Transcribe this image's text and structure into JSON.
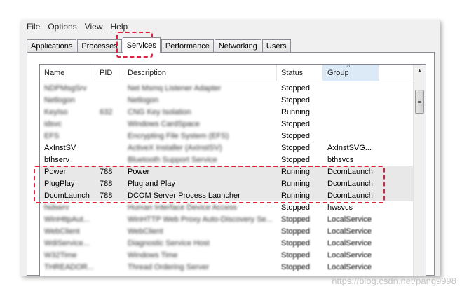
{
  "menu": [
    "File",
    "Options",
    "View",
    "Help"
  ],
  "tabs": [
    "Applications",
    "Processes",
    "Services",
    "Performance",
    "Networking",
    "Users"
  ],
  "active_tab": "Services",
  "columns": [
    "Name",
    "PID",
    "Description",
    "Status",
    "Group"
  ],
  "sorted_column": "Group",
  "rows": [
    {
      "name": "NDPMsgSrv",
      "pid": "",
      "desc": "Net Msmq Listener Adapter",
      "status": "Stopped",
      "group": ""
    },
    {
      "name": "Netlogon",
      "pid": "",
      "desc": "Netlogon",
      "status": "Stopped",
      "group": ""
    },
    {
      "name": "KeyIso",
      "pid": "632",
      "desc": "CNG Key Isolation",
      "status": "Running",
      "group": ""
    },
    {
      "name": "idsvc",
      "pid": "",
      "desc": "Windows CardSpace",
      "status": "Stopped",
      "group": ""
    },
    {
      "name": "EFS",
      "pid": "",
      "desc": "Encrypting File System (EFS)",
      "status": "Stopped",
      "group": ""
    },
    {
      "name": "AxInstSV",
      "pid": "",
      "desc": "ActiveX Installer (AxInstSV)",
      "status": "Stopped",
      "group": "AxInstSVG..."
    },
    {
      "name": "bthserv",
      "pid": "",
      "desc": "Bluetooth Support Service",
      "status": "Stopped",
      "group": "bthsvcs"
    },
    {
      "name": "Power",
      "pid": "788",
      "desc": "Power",
      "status": "Running",
      "group": "DcomLaunch"
    },
    {
      "name": "PlugPlay",
      "pid": "788",
      "desc": "Plug and Play",
      "status": "Running",
      "group": "DcomLaunch"
    },
    {
      "name": "DcomLaunch",
      "pid": "788",
      "desc": "DCOM Server Process Launcher",
      "status": "Running",
      "group": "DcomLaunch"
    },
    {
      "name": "hidserv",
      "pid": "",
      "desc": "Human Interface Device Access",
      "status": "Stopped",
      "group": "hwsvcs"
    },
    {
      "name": "WinHttpAut...",
      "pid": "",
      "desc": "WinHTTP Web Proxy Auto-Discovery Se...",
      "status": "Stopped",
      "group": "LocalService"
    },
    {
      "name": "WebClient",
      "pid": "",
      "desc": "WebClient",
      "status": "Stopped",
      "group": "LocalService"
    },
    {
      "name": "WdiService...",
      "pid": "",
      "desc": "Diagnostic Service Host",
      "status": "Stopped",
      "group": "LocalService"
    },
    {
      "name": "W32Time",
      "pid": "",
      "desc": "Windows Time",
      "status": "Stopped",
      "group": "LocalService"
    },
    {
      "name": "THREADOR...",
      "pid": "",
      "desc": "Thread Ordering Server",
      "status": "Stopped",
      "group": "LocalService"
    }
  ],
  "watermark": "https://blog.csdn.net/pang9998"
}
